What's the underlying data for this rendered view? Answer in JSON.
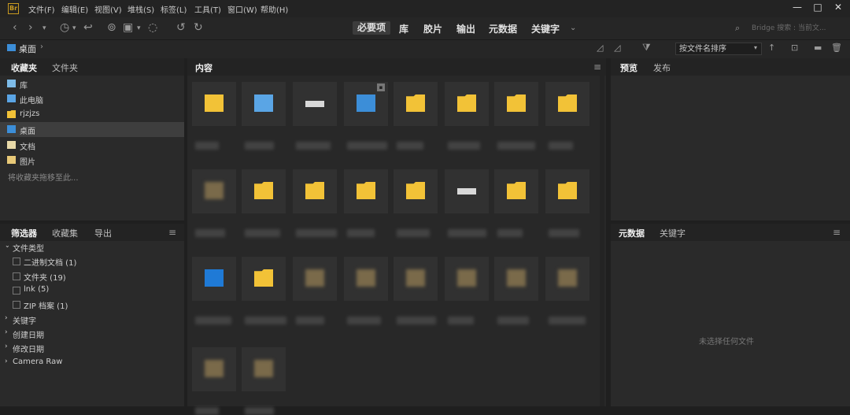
{
  "menubar": {
    "app_icon": "Br",
    "items": [
      "文件(F)",
      "编辑(E)",
      "视图(V)",
      "堆栈(S)",
      "标签(L)",
      "工具(T)",
      "窗口(W)",
      "帮助(H)"
    ]
  },
  "toolbar": {
    "workspace_tabs": [
      "必要项",
      "库",
      "胶片",
      "输出",
      "元数据",
      "关键字"
    ],
    "search_placeholder": "Bridge 搜索 : 当前文..."
  },
  "pathbar": {
    "breadcrumb": "桌面",
    "sort_label": "按文件名排序"
  },
  "left_top_panel": {
    "tabs": [
      "收藏夹",
      "文件夹"
    ],
    "items": [
      {
        "label": "库",
        "icon": "library-icon"
      },
      {
        "label": "此电脑",
        "icon": "computer-icon"
      },
      {
        "label": "rjzjzs",
        "icon": "folder-icon"
      },
      {
        "label": "桌面",
        "icon": "desktop-icon",
        "selected": true
      },
      {
        "label": "文档",
        "icon": "document-icon"
      },
      {
        "label": "图片",
        "icon": "pictures-icon"
      }
    ],
    "drag_hint": "将收藏夹拖移至此..."
  },
  "filter_panel": {
    "tabs": [
      "筛选器",
      "收藏集",
      "导出"
    ],
    "section_file_type": "文件类型",
    "file_types": [
      "二进制文档 (1)",
      "文件夹 (19)",
      "lnk (5)",
      "ZIP 档案 (1)"
    ],
    "sections": [
      "关键字",
      "创建日期",
      "修改日期",
      "Camera Raw"
    ]
  },
  "content_panel": {
    "title": "内容",
    "thumbnails": [
      "explorer-folder-icon",
      "computer-icon",
      "drive-icon",
      "network-locked-icon",
      "folder-icon",
      "folder-icon",
      "folder-icon",
      "folder-icon",
      "image-blurred-icon",
      "folder-icon",
      "folder-icon",
      "folder-icon",
      "folder-icon",
      "drive-icon",
      "folder-icon",
      "folder-icon",
      "onedrive-icon",
      "folder-icon",
      "image-blurred-icon",
      "image-blurred-icon",
      "image-blurred-icon",
      "image-blurred-icon",
      "image-blurred-icon",
      "image-blurred-icon",
      "image-blurred-icon",
      "image-blurred-icon"
    ]
  },
  "preview_panel": {
    "tabs": [
      "预览",
      "发布"
    ]
  },
  "metadata_panel": {
    "tabs": [
      "元数据",
      "关键字"
    ],
    "empty_message": "未选择任何文件"
  },
  "colors": {
    "folder": "#f2c237",
    "accent_blue": "#3c8ed8"
  }
}
